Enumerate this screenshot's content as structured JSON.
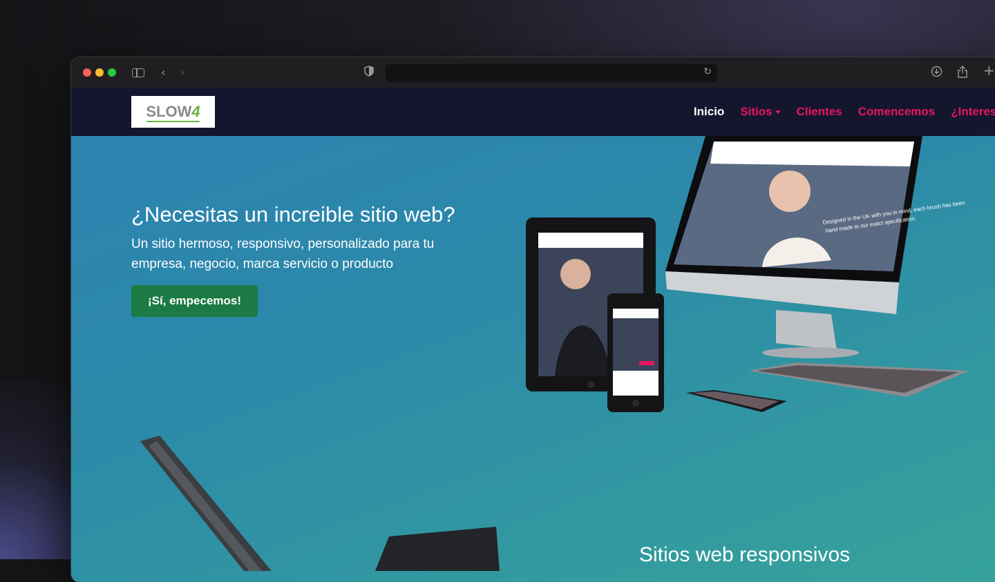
{
  "nav": {
    "logo_text": "SLOW",
    "logo_accent": "4",
    "links": [
      {
        "label": "Inicio",
        "active": true
      },
      {
        "label": "Sitios",
        "dropdown": true
      },
      {
        "label": "Clientes"
      },
      {
        "label": "Comencemos"
      },
      {
        "label": "¿Interesado?"
      }
    ]
  },
  "hero": {
    "title": "¿Necesitas un increible sitio web?",
    "subtitle": "Un sitio hermoso, responsivo, personalizado para tu empresa, negocio, marca servicio o producto",
    "cta_label": "¡Sí, empecemos!",
    "mockup_caption_1": "Designed in the UK with you in mind, each brush has been",
    "mockup_caption_2": "hand made to our exact specification."
  },
  "section": {
    "heading": "Sitios web responsivos"
  },
  "colors": {
    "nav_bg": "#14162e",
    "nav_link": "#e8155f",
    "cta_bg": "#1c7a44",
    "hero_gradient_start": "#2c83b0",
    "hero_gradient_end": "#37a39b"
  }
}
